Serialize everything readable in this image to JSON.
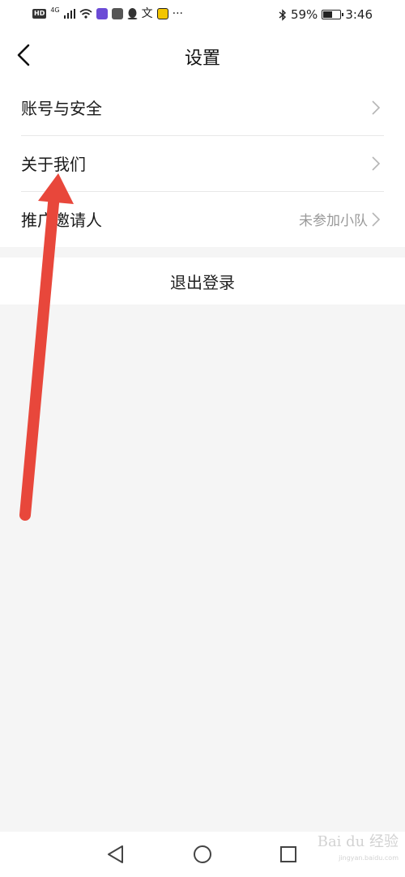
{
  "status_bar": {
    "hd_badge": "HD",
    "network_type": "4G",
    "extra_glyph": "文",
    "more_indicator": "···",
    "battery_text": "59%",
    "battery_level_percent": 59,
    "time": "3:46",
    "icons": [
      "hd-icon",
      "signal-icon",
      "wifi-icon",
      "app-icon-purple",
      "app-icon-hand",
      "qq-icon",
      "text-icon",
      "app-icon-yellow",
      "bluetooth-icon",
      "battery-icon"
    ]
  },
  "header": {
    "title": "设置",
    "back_icon": "chevron-left-icon"
  },
  "settings": {
    "items": [
      {
        "label": "账号与安全",
        "value": ""
      },
      {
        "label": "关于我们",
        "value": ""
      },
      {
        "label": "推广邀请人",
        "value": "未参加小队"
      }
    ]
  },
  "logout": {
    "label": "退出登录"
  },
  "system_nav": {
    "buttons": [
      "back-triangle-icon",
      "home-circle-icon",
      "recents-square-icon"
    ]
  },
  "annotation": {
    "arrow_color": "#e8473b"
  },
  "watermark": {
    "text": "Bai du 经验",
    "sub": "jingyan.baidu.com"
  },
  "colors": {
    "background": "#f5f5f5",
    "surface": "#ffffff",
    "secondary_text": "#999999"
  }
}
